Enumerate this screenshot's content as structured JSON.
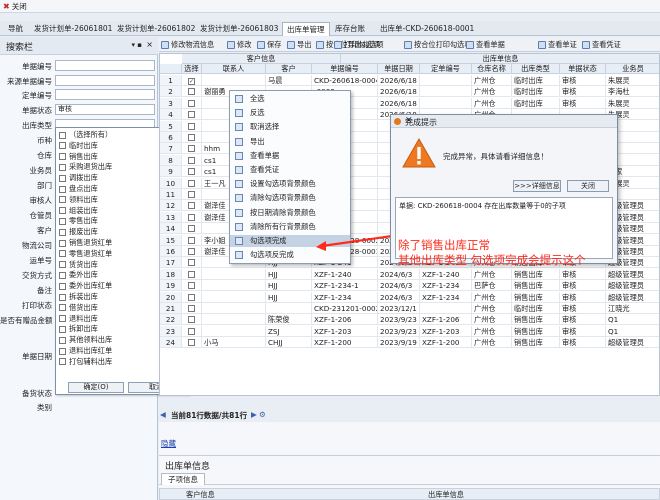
{
  "app": {
    "close_label": "关闭"
  },
  "tabs": [
    "导航",
    "发货计划单-26061801",
    "发货计划单-26061802",
    "发货计划单-26061803",
    "出库单管理",
    "库存台账",
    "出库单-CKD-260618-0001"
  ],
  "left": {
    "title": "搜索栏",
    "fields": [
      {
        "label": "单据编号",
        "value": ""
      },
      {
        "label": "来源单据编号",
        "value": ""
      },
      {
        "label": "定单编号",
        "value": ""
      },
      {
        "label": "单据状态",
        "value": "审核"
      },
      {
        "label": "出库类型",
        "value": ""
      },
      {
        "label": "币种",
        "value": ""
      },
      {
        "label": "仓库",
        "value": ""
      },
      {
        "label": "业务员",
        "value": ""
      },
      {
        "label": "部门",
        "value": ""
      },
      {
        "label": "审核人",
        "value": ""
      },
      {
        "label": "仓管员",
        "value": ""
      },
      {
        "label": "客户",
        "value": ""
      },
      {
        "label": "物流公司",
        "value": ""
      },
      {
        "label": "运单号",
        "value": ""
      },
      {
        "label": "交货方式",
        "value": ""
      },
      {
        "label": "备注",
        "value": ""
      },
      {
        "label": "打印状态",
        "value": ""
      },
      {
        "label": "是否有赠品金额",
        "value": ""
      },
      {
        "label": "单据日期",
        "value": ""
      },
      {
        "label": "备货状态",
        "value": ""
      },
      {
        "label": "类别",
        "value": ""
      }
    ],
    "type_options": [
      "（选择所有）",
      "临时出库",
      "销售出库",
      "采购退货出库",
      "调拨出库",
      "盘点出库",
      "领料出库",
      "组装出库",
      "零售出库",
      "报废出库",
      "销售退货红单",
      "零售退货红单",
      "赁货出库",
      "委外出库",
      "委外出库红单",
      "拆装出库",
      "借货出库",
      "退料出库",
      "拆卸出库",
      "其他领料出库",
      "退料出库红单",
      "打包辅料出库"
    ],
    "confirm_label": "确定(O)",
    "cancel_label": "取消"
  },
  "toolbar": [
    "修改物流信息",
    "修改",
    "保存",
    "导出",
    "按合位导出勾选项",
    "打印勾选项",
    "按合位打印勾选项",
    "查看单据",
    "查看单证",
    "查看凭证"
  ],
  "grid": {
    "group_left": "客户信息",
    "group_right": "出库单信息",
    "headers": [
      "选择",
      "联系人",
      "客户",
      "单据编号",
      "单据日期",
      "定单编号",
      "仓库名称",
      "出库类型",
      "单据状态",
      "业务员"
    ],
    "rows": [
      {
        "n": "1",
        "contact": "",
        "customer": "马晨",
        "no": "CKD-260618-0004",
        "date": "2026/6/18",
        "order": "",
        "wh": "广州仓",
        "type": "临时出库",
        "status": "审核",
        "sales": "朱展灵"
      },
      {
        "n": "2",
        "contact": "谢丽勇",
        "customer": "",
        "no": "-0003",
        "date": "2026/6/18",
        "order": "",
        "wh": "广州仓",
        "type": "临时出库",
        "status": "审核",
        "sales": "李海杜"
      },
      {
        "n": "3",
        "contact": "",
        "customer": "",
        "no": "-0002",
        "date": "2026/6/18",
        "order": "",
        "wh": "广州仓",
        "type": "临时出库",
        "status": "审核",
        "sales": "朱展灵"
      },
      {
        "n": "4",
        "contact": "",
        "customer": "",
        "no": "-0001",
        "date": "2026/6/18",
        "order": "",
        "wh": "广州仓",
        "type": "",
        "status": "",
        "sales": "朱展灵"
      },
      {
        "n": "5",
        "contact": "",
        "customer": "",
        "no": "",
        "date": "",
        "order": "",
        "wh": "",
        "type": "",
        "status": "",
        "sales": ""
      },
      {
        "n": "6",
        "contact": "",
        "customer": "",
        "no": "",
        "date": "",
        "order": "",
        "wh": "",
        "type": "",
        "status": "",
        "sales": ""
      },
      {
        "n": "7",
        "contact": "hhm",
        "customer": "",
        "no": "",
        "date": "",
        "order": "",
        "wh": "",
        "type": "",
        "status": "",
        "sales": "2"
      },
      {
        "n": "8",
        "contact": "cs1",
        "customer": "",
        "no": "",
        "date": "",
        "order": "",
        "wh": "",
        "type": "",
        "status": "",
        "sales": "2"
      },
      {
        "n": "9",
        "contact": "cs1",
        "customer": "",
        "no": "",
        "date": "",
        "order": "",
        "wh": "",
        "type": "",
        "status": "",
        "sales": "管家"
      },
      {
        "n": "10",
        "contact": "王一凡",
        "customer": "",
        "no": "",
        "date": "",
        "order": "",
        "wh": "",
        "type": "",
        "status": "",
        "sales": "朱展灵"
      },
      {
        "n": "11",
        "contact": "",
        "customer": "",
        "no": "",
        "date": "",
        "order": "",
        "wh": "",
        "type": "",
        "status": "",
        "sales": ""
      },
      {
        "n": "12",
        "contact": "谢泽佳",
        "customer": "",
        "no": "",
        "date": "",
        "order": "",
        "wh": "",
        "type": "",
        "status": "",
        "sales": "超级管理员"
      },
      {
        "n": "13",
        "contact": "谢泽佳",
        "customer": "",
        "no": "",
        "date": "",
        "order": "",
        "wh": "",
        "type": "",
        "status": "",
        "sales": "超级管理员"
      },
      {
        "n": "14",
        "contact": "",
        "customer": "",
        "no": "-0002",
        "date": "",
        "order": "",
        "wh": "",
        "type": "",
        "status": "",
        "sales": "超级管理员"
      },
      {
        "n": "15",
        "contact": "李小姐",
        "customer": "灭霸的存...",
        "no": "CKD-240628-0002",
        "date": "2024/6/28",
        "order": "",
        "wh": "",
        "type": "",
        "status": "",
        "sales": "超级管理员"
      },
      {
        "n": "16",
        "contact": "谢泽佳",
        "customer": "以颜倚颜",
        "no": "CKD-240628-0001",
        "date": "2024/6/28",
        "order": "",
        "wh": "",
        "type": "",
        "status": "",
        "sales": "超级管理员"
      },
      {
        "n": "17",
        "contact": "",
        "customer": "HJJ",
        "no": "XZF-1-241",
        "date": "2024/6/3",
        "order": "XZF-1-241",
        "wh": "广州仓",
        "type": "销售出库",
        "status": "审核",
        "sales": "超级管理员"
      },
      {
        "n": "18",
        "contact": "",
        "customer": "HJJ",
        "no": "XZF-1-240",
        "date": "2024/6/3",
        "order": "XZF-1-240",
        "wh": "广州仓",
        "type": "销售出库",
        "status": "审核",
        "sales": "超级管理员"
      },
      {
        "n": "19",
        "contact": "",
        "customer": "HJJ",
        "no": "XZF-1-234-1",
        "date": "2024/6/3",
        "order": "XZF-1-234",
        "wh": "巴萨仓",
        "type": "销售出库",
        "status": "审核",
        "sales": "超级管理员"
      },
      {
        "n": "20",
        "contact": "",
        "customer": "HJJ",
        "no": "XZF-1-234",
        "date": "2024/6/3",
        "order": "XZF-1-234",
        "wh": "广州仓",
        "type": "销售出库",
        "status": "审核",
        "sales": "超级管理员"
      },
      {
        "n": "21",
        "contact": "",
        "customer": "",
        "no": "CKD-231201-0002",
        "date": "2023/12/1",
        "order": "",
        "wh": "广州仓",
        "type": "临时出库",
        "status": "审核",
        "sales": "江晓光"
      },
      {
        "n": "22",
        "contact": "",
        "customer": "陈荣俊",
        "no": "XZF-1-206",
        "date": "2023/9/23",
        "order": "XZF-1-206",
        "wh": "广州仓",
        "type": "销售出库",
        "status": "审核",
        "sales": "Q1"
      },
      {
        "n": "23",
        "contact": "",
        "customer": "ZSJ",
        "no": "XZF-1-203",
        "date": "2023/9/23",
        "order": "XZF-1-203",
        "wh": "广州仓",
        "type": "销售出库",
        "status": "审核",
        "sales": "Q1"
      },
      {
        "n": "24",
        "contact": "小马",
        "customer": "CHJJ",
        "no": "XZF-1-200",
        "date": "2023/9/19",
        "order": "XZF-1-200",
        "wh": "广州仓",
        "type": "销售出库",
        "status": "审核",
        "sales": "超级管理员"
      }
    ]
  },
  "context_menu": [
    "全选",
    "反选",
    "取消选择",
    "导出",
    "查看单据",
    "查看凭证",
    "设置勾选项背景颜色",
    "清除勾选项背景颜色",
    "按日期清除背景颜色",
    "清除所有行背景颜色",
    "勾选项完成",
    "勾选项反完成"
  ],
  "dialog": {
    "title": "完成提示",
    "message": "完成异常，具体请看详细信息！",
    "detail_button": ">>>详细信息",
    "close_button": "关闭",
    "detail_text": "单据: CKD-260618-0004 存在出库数量等于0的子项"
  },
  "annotation": {
    "line1": "除了销售出库正常",
    "line2": "其他出库类型  勾选项完成会提示这个"
  },
  "pager": {
    "text": "当前81行数据/共81行"
  },
  "bottom": {
    "link": "隐藏",
    "section_title": "出库单信息",
    "subtab": "子项信息",
    "hdr_left": "客户信息",
    "hdr_right": "出库单信息"
  },
  "colors": {
    "annotation": "#ff2a1a",
    "warning": "#f0781e",
    "highlight": "#c5d2e3"
  }
}
